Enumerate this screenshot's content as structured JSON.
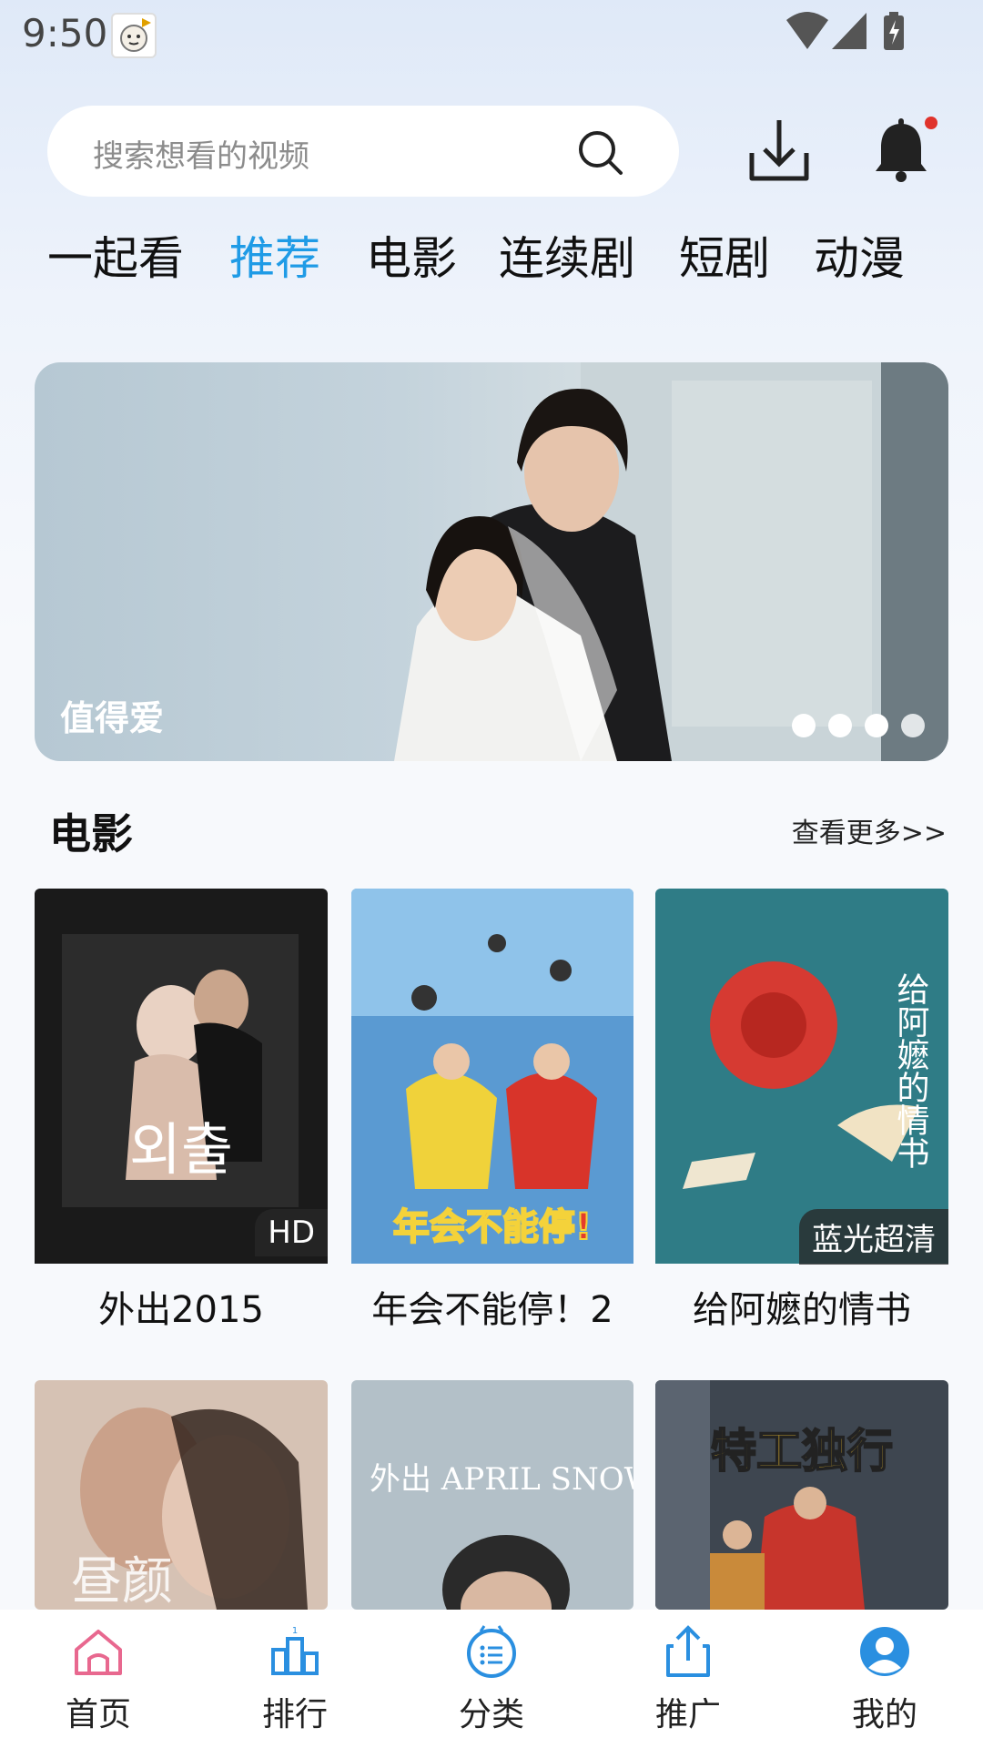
{
  "status_bar": {
    "time": "9:50"
  },
  "search": {
    "placeholder": "搜索想看的视频"
  },
  "tabs": [
    {
      "label": "一起看"
    },
    {
      "label": "推荐",
      "active": true
    },
    {
      "label": "电影"
    },
    {
      "label": "连续剧"
    },
    {
      "label": "短剧"
    },
    {
      "label": "动漫"
    }
  ],
  "banner": {
    "title": "值得爱",
    "pages": 4,
    "current_page": 4
  },
  "section": {
    "title": "电影",
    "more_label": "查看更多>>"
  },
  "movies": [
    {
      "title": "外出2015",
      "quality": "HD",
      "poster_text": "외출"
    },
    {
      "title": "年会不能停！2",
      "quality": "",
      "poster_text": "年会不能停!"
    },
    {
      "title": "给阿嬷的情书",
      "quality": "蓝光超清",
      "poster_text": "给阿嬷的情书"
    },
    {
      "title": "",
      "quality": "",
      "poster_text": "昼颜"
    },
    {
      "title": "",
      "quality": "",
      "poster_text": "外出 APRIL SNOW"
    },
    {
      "title": "",
      "quality": "",
      "poster_text": "特工独行"
    }
  ],
  "bottom_nav": [
    {
      "label": "首页",
      "icon": "home-icon",
      "active": true
    },
    {
      "label": "排行",
      "icon": "ranking-icon"
    },
    {
      "label": "分类",
      "icon": "category-icon"
    },
    {
      "label": "推广",
      "icon": "share-icon"
    },
    {
      "label": "我的",
      "icon": "profile-icon"
    }
  ],
  "colors": {
    "accent": "#1f9be6",
    "home_active": "#e8688f",
    "nav_icon": "#2a8fe0",
    "notify_dot": "#e0322b"
  }
}
